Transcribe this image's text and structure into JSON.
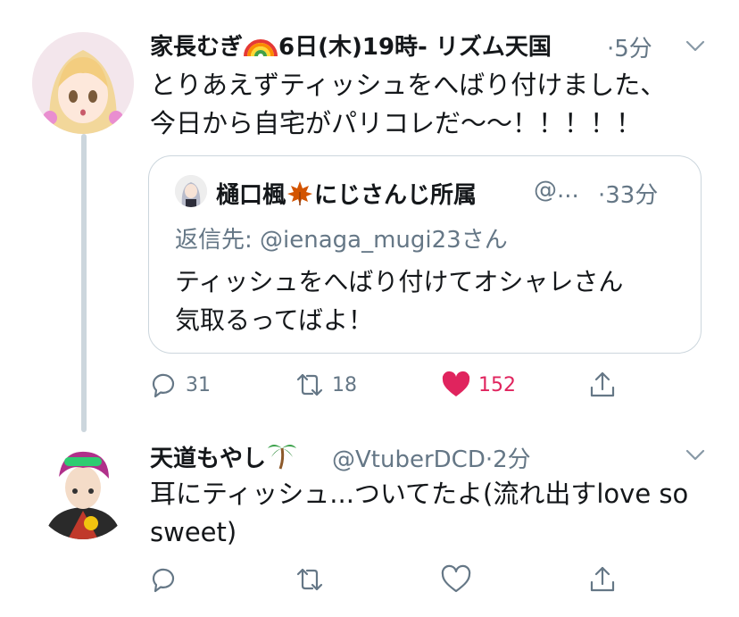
{
  "tweet1": {
    "display_name": "家長むぎ",
    "name_suffix": "6日(木)19時- リズム天国",
    "sep": "·",
    "time": "5分",
    "text_line1": "とりあえずティッシュをへばり付けました、",
    "text_line2": "今日から自宅がパリコレだ〜〜！！！！！",
    "actions": {
      "reply_count": "31",
      "retweet_count": "18",
      "like_count": "152"
    },
    "like_color": "#e0245e"
  },
  "quote": {
    "display_name": "樋口楓",
    "name_suffix": "にじさんじ所属",
    "handle": "@...",
    "sep": "·",
    "time": "33分",
    "reply_to_prefix": "返信先:",
    "reply_to_handle": "@ienaga_mugi23さん",
    "text_line1": "ティッシュをへばり付けてオシャレさん",
    "text_line2": "気取るってばよ！"
  },
  "tweet2": {
    "display_name": "天道もやし",
    "handle": "@VtuberDCD",
    "sep": "·",
    "time": "2分",
    "text_line1": "耳にティッシュ...ついてたよ(流れ出すlove so",
    "text_line2": "sweet)"
  },
  "icons": [
    "chevron-down-icon",
    "reply-icon",
    "retweet-icon",
    "heart-icon",
    "share-icon",
    "rainbow-emoji",
    "maple-leaf-emoji",
    "palm-tree-emoji"
  ],
  "colors": {
    "secondary_text": "#657786",
    "border": "#ccd6dd",
    "like": "#e0245e"
  }
}
